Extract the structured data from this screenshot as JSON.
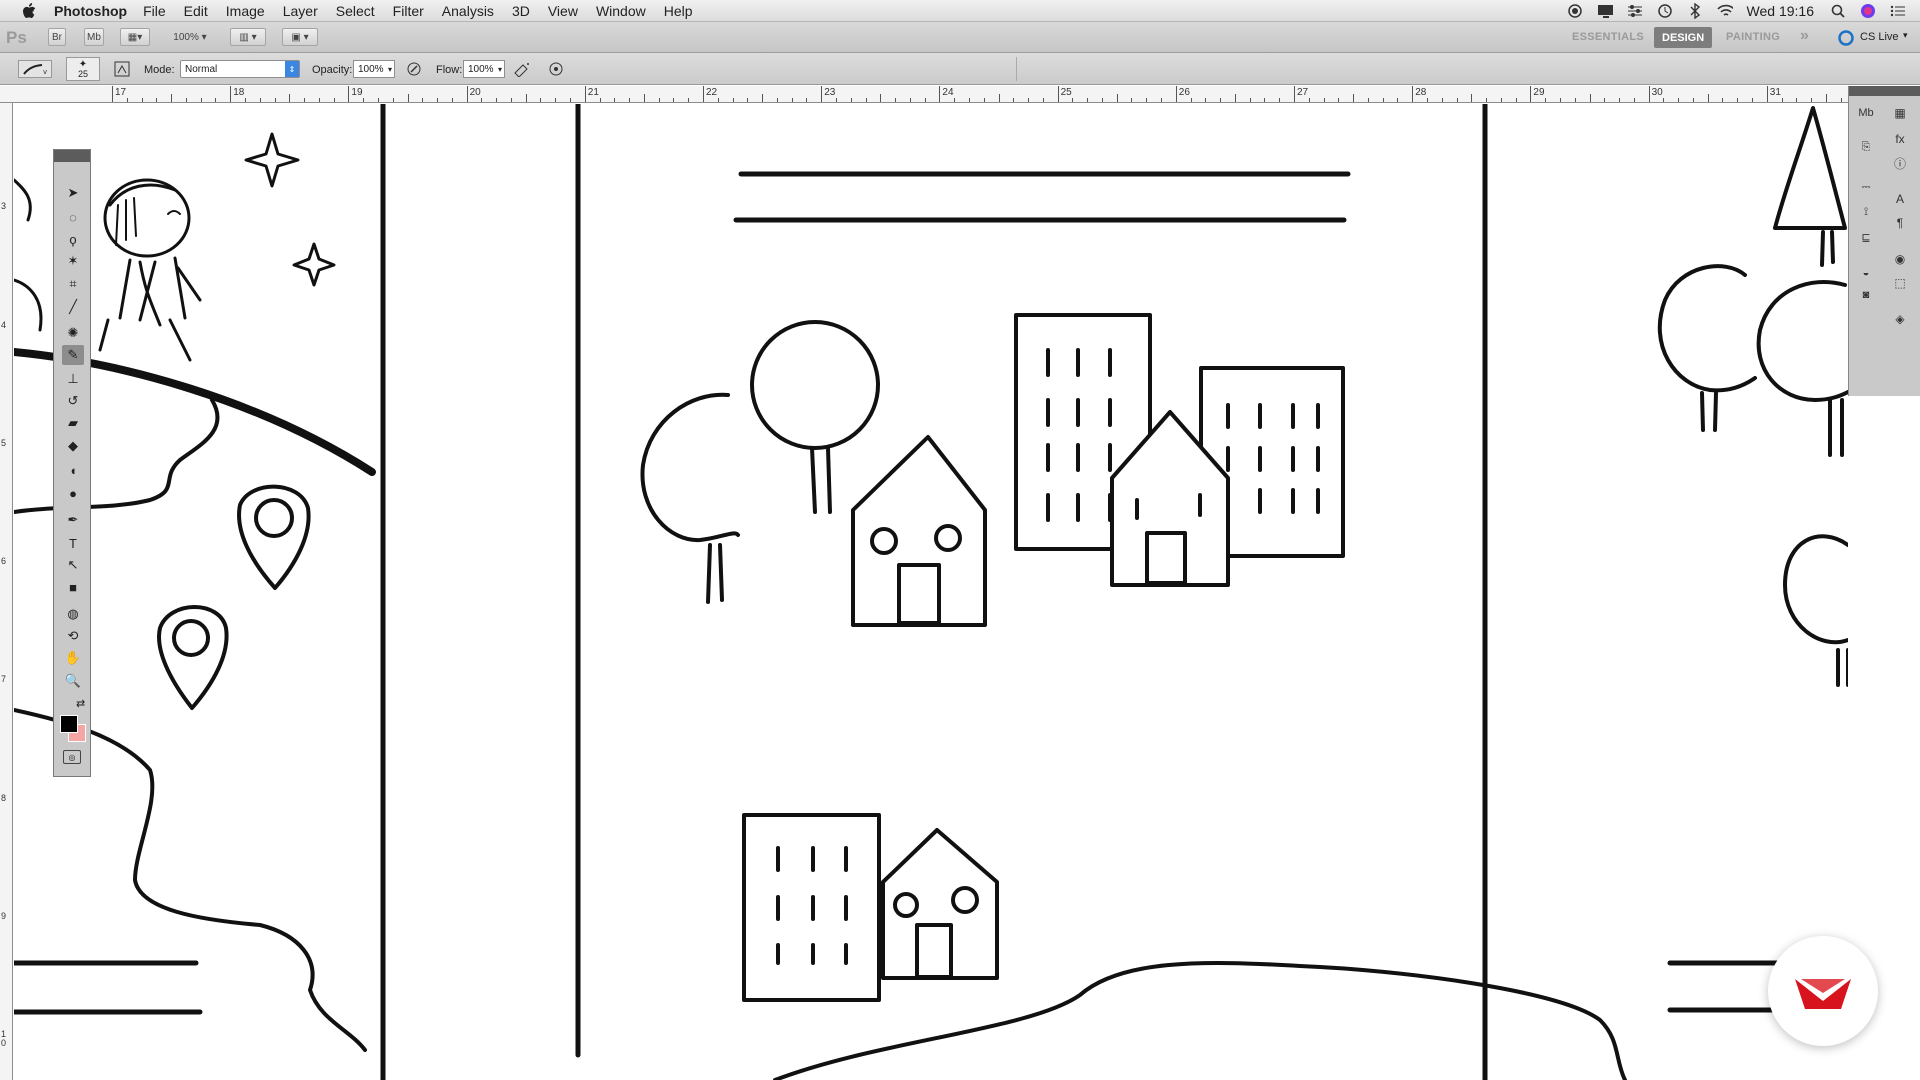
{
  "menubar": {
    "app_name": "Photoshop",
    "items": [
      "File",
      "Edit",
      "Image",
      "Layer",
      "Select",
      "Filter",
      "Analysis",
      "3D",
      "View",
      "Window",
      "Help"
    ],
    "clock": "Wed 19:16",
    "tray_icons": [
      "record-icon",
      "display-icon",
      "sliders-icon",
      "time-machine-icon",
      "bluetooth-icon",
      "wifi-icon",
      "search-icon",
      "siri-icon",
      "notification-list-icon"
    ]
  },
  "appbar": {
    "logo": "Ps",
    "bridge": "Br",
    "minibridge": "Mb",
    "zoom": "100%",
    "workspaces": [
      "ESSENTIALS",
      "DESIGN",
      "PAINTING"
    ],
    "active_workspace": "DESIGN",
    "more": "»",
    "cslive": "CS Live"
  },
  "options": {
    "brush_size": "25",
    "mode_label": "Mode:",
    "mode_value": "Normal",
    "opacity_label": "Opacity:",
    "opacity_value": "100%",
    "flow_label": "Flow:",
    "flow_value": "100%"
  },
  "ruler_top": [
    "17",
    "18",
    "19",
    "20",
    "21",
    "22",
    "23",
    "24",
    "25",
    "26",
    "27",
    "28",
    "29",
    "30",
    "31"
  ],
  "ruler_left": [
    "3",
    "4",
    "5",
    "6",
    "7",
    "8",
    "9",
    "1\n0"
  ],
  "tools": [
    "move-tool-icon",
    "marquee-tool-icon",
    "lasso-tool-icon",
    "magic-wand-icon",
    "crop-tool-icon",
    "eyedropper-icon",
    "spot-heal-icon",
    "brush-tool-icon",
    "stamp-tool-icon",
    "history-brush-icon",
    "eraser-icon",
    "bucket-icon",
    "blur-tool-icon",
    "dodge-tool-icon",
    "pen-tool-icon",
    "type-tool-icon",
    "path-select-icon",
    "rectangle-tool-icon",
    "3d-rotate-icon",
    "3d-orbit-icon",
    "hand-tool-icon",
    "zoom-tool-icon"
  ],
  "colors": {
    "foreground": "#000000",
    "background": "#f4a6a6",
    "badge": "#d7131d"
  }
}
